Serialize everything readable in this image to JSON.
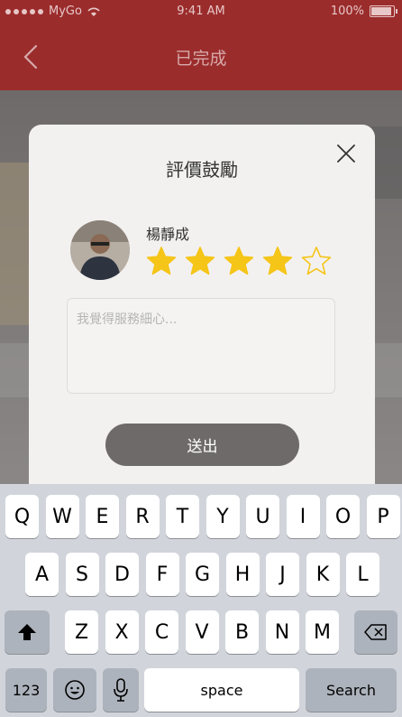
{
  "status_bar": {
    "carrier": "MyGo",
    "time": "9:41 AM",
    "battery": "100%"
  },
  "nav": {
    "title": "已完成",
    "back_icon": "chevron-left-icon"
  },
  "modal": {
    "title": "評價鼓勵",
    "close_icon": "close-icon",
    "user_name": "楊靜成",
    "rating": {
      "value": 4,
      "max": 5
    },
    "comment_placeholder": "我覺得服務細心...",
    "submit_label": "送出"
  },
  "keyboard": {
    "row1": [
      "Q",
      "W",
      "E",
      "R",
      "T",
      "Y",
      "U",
      "I",
      "O",
      "P"
    ],
    "row2": [
      "A",
      "S",
      "D",
      "F",
      "G",
      "H",
      "J",
      "K",
      "L"
    ],
    "row3": [
      "Z",
      "X",
      "C",
      "V",
      "B",
      "N",
      "M"
    ],
    "shift_icon": "shift-icon",
    "delete_icon": "delete-icon",
    "numbers_label": "123",
    "emoji_icon": "emoji-icon",
    "mic_icon": "microphone-icon",
    "space_label": "space",
    "search_label": "Search"
  },
  "colors": {
    "header": "#9b2c2c",
    "star": "#f5c518",
    "submit": "#6e6a69"
  }
}
